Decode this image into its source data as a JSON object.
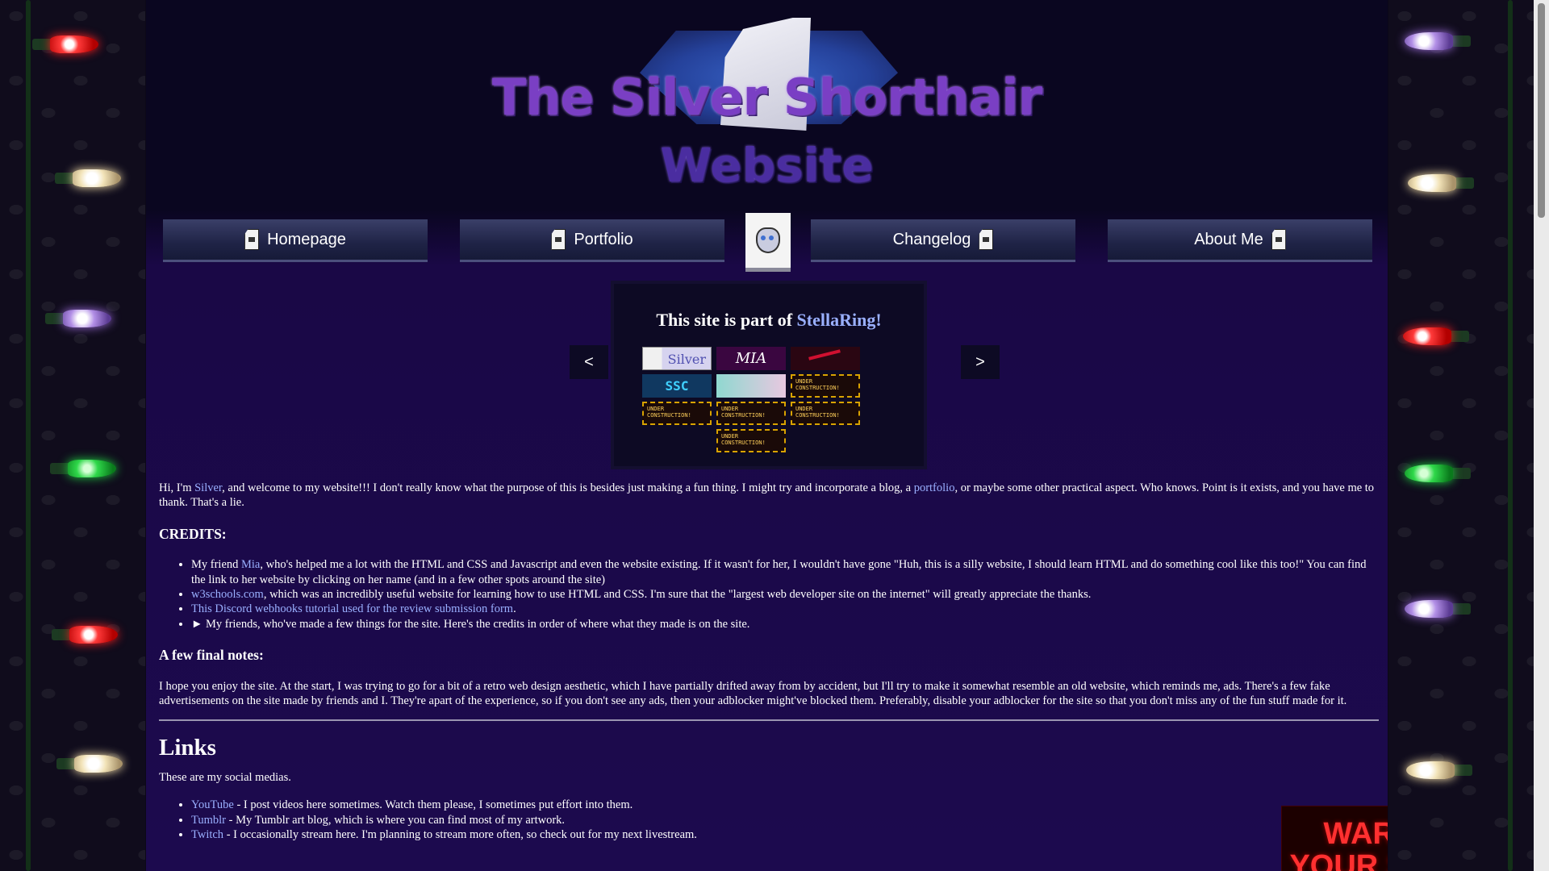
{
  "logo": {
    "title": "The Silver Shorthair",
    "subtitle": "Website"
  },
  "nav": {
    "items": [
      {
        "label": "Homepage"
      },
      {
        "label": "Portfolio"
      },
      {
        "label": "Changelog"
      },
      {
        "label": "About Me"
      }
    ]
  },
  "webring": {
    "title_prefix": "This site is part of ",
    "ring_name": "StellaRing!",
    "prev_label": "<",
    "next_label": ">",
    "sites": {
      "silver": "Silver",
      "mia": "MIA",
      "ssc": "SSC",
      "under_construction": "UNDER CONSTRUCTION!"
    }
  },
  "intro": {
    "t1": "Hi, I'm ",
    "silver_link": "Silver",
    "t2": ", and welcome to my website!!! I don't really know what the purpose of this is besides just making a fun thing. I might try and incorporate a blog, a ",
    "portfolio_link": "portfolio",
    "t3": ", or maybe some other practical aspect. Who knows. Point is it exists, and you have me to thank. That's a lie."
  },
  "credits": {
    "heading": "CREDITS:",
    "item1_pre": "My friend ",
    "item1_link": "Mia",
    "item1_post": ", who's helped me a lot with the HTML and CSS and Javascript and even the website existing. If it wasn't for her, I wouldn't have gone \"Huh, this is a silly website, I should learn HTML and do something cool like this too!\" You can find the link to her website by clicking on her name (and in a few other spots around the site)",
    "item2_link": "w3schools.com",
    "item2_post": ", which was an incredibly useful website for learning how to use HTML and CSS. I'm sure that the \"largest web developer site on the internet\" will greatly appreciate the thanks.",
    "item3_link": "This Discord webhooks tutorial used for the review submission form",
    "item3_post": ".",
    "item4": "► My friends, who've made a few things for the site. Here's the credits in order of where what they made is on the site."
  },
  "final_notes": {
    "heading": "A few final notes:",
    "text": "I hope you enjoy the site. At the start, I was trying to go for a bit of a retro web design aesthetic, which I have partially drifted away from by accident, but I'll try to make it somewhat resemble an old website, which reminds me, ads. There's a few fake advertisements on the site made by friends and I. They're apart of the experience, so if you don't see any ads, then your adblocker might've blocked them. Preferably, disable your adblocker for the site so that you don't miss any of the fun stuff made for it."
  },
  "links": {
    "heading": "Links",
    "intro": "These are my social medias.",
    "items": [
      {
        "name": "YouTube",
        "desc": " - I post videos here sometimes. Watch them please, I sometimes put effort into them."
      },
      {
        "name": "Tumblr",
        "desc": " - My Tumblr art blog, which is where you can find most of my artwork."
      },
      {
        "name": "Twitch",
        "desc": " - I occasionally stream here. I'm planning to stream more often, so check out for my next livestream."
      }
    ]
  },
  "ad": {
    "text_line1": "WARNING:",
    "text_line2": "YOUR SILVERS"
  },
  "colors": {
    "link": "#9ab0ff",
    "background": "#1c0a4e",
    "nav_button": "#1f2346"
  }
}
